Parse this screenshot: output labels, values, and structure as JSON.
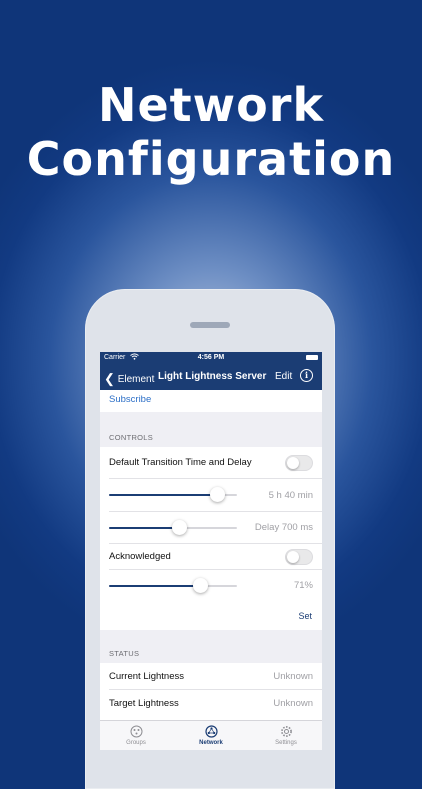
{
  "headline": {
    "line1": "Network",
    "line2": "Configuration"
  },
  "status_bar": {
    "carrier": "Carrier",
    "time": "4:56 PM"
  },
  "nav": {
    "back_label": "Element",
    "title": "Light Lightness Server",
    "edit_label": "Edit"
  },
  "subscribe_label": "Subscribe",
  "controls": {
    "header": "CONTROLS",
    "transition_label": "Default Transition Time and Delay",
    "transition_toggle_on": false,
    "transition_time": {
      "value": "5 h 40 min",
      "level": 0.84
    },
    "delay": {
      "value": "Delay 700 ms",
      "level": 0.55
    },
    "acknowledged_label": "Acknowledged",
    "acknowledged_on": false,
    "lightness": {
      "value": "71%",
      "level": 0.71
    },
    "set_label": "Set"
  },
  "status": {
    "header": "STATUS",
    "rows": [
      {
        "label": "Current Lightness",
        "value": "Unknown"
      },
      {
        "label": "Target Lightness",
        "value": "Unknown"
      }
    ]
  },
  "tabs": [
    {
      "label": "Groups",
      "icon": "groups-icon",
      "active": false
    },
    {
      "label": "Network",
      "icon": "network-icon",
      "active": true
    },
    {
      "label": "Settings",
      "icon": "gear-icon",
      "active": false
    }
  ],
  "colors": {
    "nav_bar": "#1b3d74",
    "link": "#2c6fc7",
    "background": "#123a82"
  }
}
